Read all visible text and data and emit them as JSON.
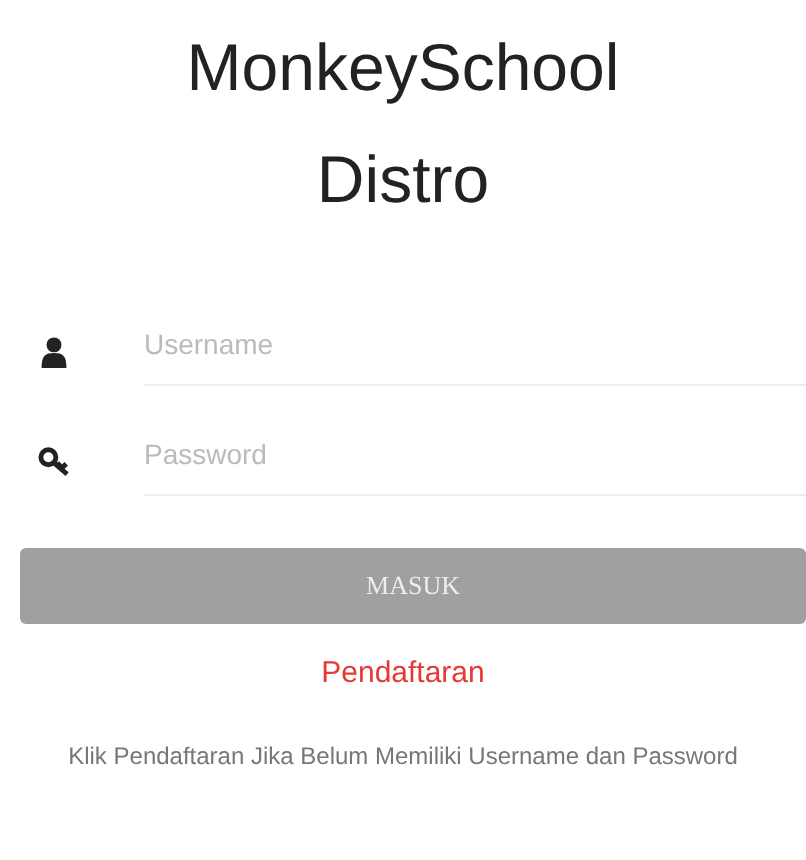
{
  "title": "MonkeySchool Distro",
  "fields": [
    {
      "kind": "user",
      "placeholder": "Username"
    },
    {
      "kind": "key",
      "placeholder": "Password"
    }
  ],
  "submit": "MASUK",
  "register_link": "Pendaftaran",
  "note": "Klik Pendaftaran Jika Belum Memiliki Username dan Password"
}
